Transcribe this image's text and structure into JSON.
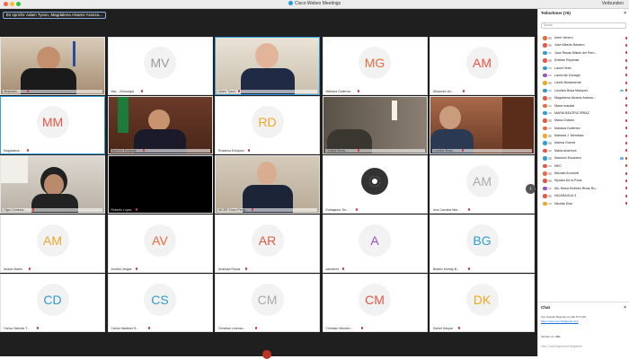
{
  "window": {
    "title": "Cisco Webex Meetings",
    "status_right": "Verbunden"
  },
  "speaking": "Es spricht:  Adam Tyson,  Magdalena Alvarez Aranza...",
  "tiles": [
    {
      "name": "Alejandro...",
      "initials": "",
      "video": true
    },
    {
      "name": "Mar... (Noruega)",
      "initials": "MV",
      "color": "#9a9a9a"
    },
    {
      "name": "Adam Tyson",
      "initials": "",
      "video": true,
      "active": true
    },
    {
      "name": "Mariana Gutierrez",
      "initials": "MG",
      "color": "#ee6a3c"
    },
    {
      "name": "Alejandro Arr...",
      "initials": "AM",
      "color": "#ee5440"
    },
    {
      "name": "Magdalena...",
      "initials": "MM",
      "color": "#ee5440",
      "active": true
    },
    {
      "name": "Mauricio Enriquez",
      "initials": "",
      "video": true
    },
    {
      "name": "Rosanna Enriquez",
      "initials": "RD",
      "color": "#f4a623"
    },
    {
      "name": "Cristina Borra...",
      "initials": "",
      "video": true
    },
    {
      "name": "Lourdes Bosa...",
      "initials": "",
      "video": true
    },
    {
      "name": "Olga Cominus...",
      "initials": "",
      "video": true
    },
    {
      "name": "Roberto Lopez",
      "initials": "",
      "video": true,
      "dark": true
    },
    {
      "name": "WCER Cisco Peng...",
      "initials": "",
      "video": true
    },
    {
      "name": "Embajador Ter...",
      "initials": "",
      "camera": true
    },
    {
      "name": "Ana Carolina Mar...",
      "initials": "AM",
      "color": "#aaaaaa"
    },
    {
      "name": "Ariana Martin",
      "initials": "AM",
      "color": "#f4a623"
    },
    {
      "name": "Andres Vargas",
      "initials": "AV",
      "color": "#ee6a3c"
    },
    {
      "name": "Analuisa Rosas",
      "initials": "AR",
      "color": "#ee5440"
    },
    {
      "name": "aanderes",
      "initials": "A",
      "color": "#a050c8"
    },
    {
      "name": "Beatriz Murray B...",
      "initials": "BG",
      "color": "#2f9bd8"
    },
    {
      "name": "Carlos Saboda T...",
      "initials": "CD",
      "color": "#2f9bd8"
    },
    {
      "name": "Carlos Martinez S...",
      "initials": "CS",
      "color": "#2f9bd8"
    },
    {
      "name": "Christian Lorenzo...",
      "initials": "CM",
      "color": "#aaaaaa"
    },
    {
      "name": "Christian Mendez...",
      "initials": "CM",
      "color": "#ee5440"
    },
    {
      "name": "Daniel Kaspar",
      "initials": "DK",
      "color": "#f4a623"
    }
  ],
  "participants": {
    "header": "Teilnehmer (76)",
    "search_placeholder": "Suche",
    "list": [
      {
        "name": "Irene Venero",
        "color": "#ee6a3c"
      },
      {
        "name": "Jose Alberto Navarro",
        "color": "#ee5440"
      },
      {
        "name": "Jose Rosas Misión del Perú...",
        "color": "#2f9bd8"
      },
      {
        "name": "Kristian Reponse",
        "color": "#ee5440"
      },
      {
        "name": "Laura Heiet",
        "color": "#2f9bd8"
      },
      {
        "name": "Laura Mc Donagh",
        "color": "#a050c8"
      },
      {
        "name": "Lizeth Bustamente",
        "color": "#f4a623"
      },
      {
        "name": "Lourdes Bosa Marquez",
        "color": "#2f9bd8",
        "cam": true
      },
      {
        "name": "Magdalena Alvarez Aranza...",
        "color": "#ee5440"
      },
      {
        "name": "Maria Inaudat",
        "color": "#ee6a3c"
      },
      {
        "name": "MARIA BEATRIZ IRRAZ",
        "color": "#2f9bd8"
      },
      {
        "name": "Maria Chávez",
        "color": "#ee5440"
      },
      {
        "name": "Mariana Gutierrez",
        "color": "#ee6a3c"
      },
      {
        "name": "Mariana J. Mendiola",
        "color": "#f4a623"
      },
      {
        "name": "Marina Guerra",
        "color": "#2f9bd8"
      },
      {
        "name": "Marta Andreoni",
        "color": "#ee5440"
      },
      {
        "name": "Mauricio Escanero",
        "color": "#2f9bd8",
        "cam": true
      },
      {
        "name": "MEC",
        "color": "#ee5440"
      },
      {
        "name": "Michael Aronhoft",
        "color": "#ee6a3c"
      },
      {
        "name": "Myriam De la Roca",
        "color": "#ee5440"
      },
      {
        "name": "Ms. María Emilsen Rivas Ro...",
        "color": "#a050c8"
      },
      {
        "name": "NICARAGUA 3",
        "color": "#ee5440"
      },
      {
        "name": "Nicolás Díaz",
        "color": "#f4a623"
      }
    ]
  },
  "chat": {
    "header": "Chat",
    "sender": "Von Hassan Bogoran an Alle",
    "time": "8:47 AM",
    "link": "https://www.cem19alqaraa.chat",
    "recipient_label": "Senden an:",
    "recipient": "Alle",
    "input_placeholder": "Hier Chat-Nachricht eingeben"
  },
  "colors": {
    "accent": "#33a0e0",
    "end": "#b32"
  }
}
